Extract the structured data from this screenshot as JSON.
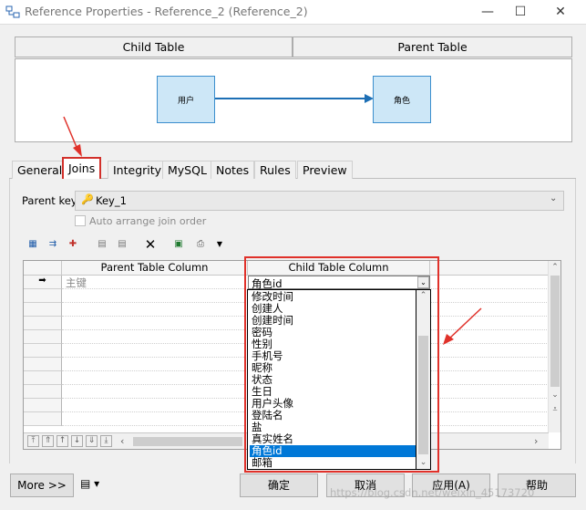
{
  "window": {
    "title": "Reference Properties - Reference_2 (Reference_2)",
    "controls": [
      "—",
      "☐",
      "✕"
    ]
  },
  "header_tabs": {
    "child": "Child Table",
    "parent": "Parent Table"
  },
  "diagram": {
    "child_entity": "用户",
    "parent_entity": "角色"
  },
  "tabs": [
    "General",
    "Joins",
    "Integrity",
    "MySQL",
    "Notes",
    "Rules",
    "Preview"
  ],
  "active_tab": "Joins",
  "parent_key": {
    "label": "Parent key:",
    "value": "Key_1"
  },
  "auto_arrange": {
    "label": "Auto arrange join order",
    "checked": false
  },
  "grid": {
    "columns": {
      "parent": "Parent Table Column",
      "child": "Child Table Column"
    },
    "rows": [
      {
        "parent": "主键",
        "child": "角色id"
      }
    ]
  },
  "dropdown": {
    "options": [
      "修改时间",
      "创建人",
      "创建时间",
      "密码",
      "性别",
      "手机号",
      "昵称",
      "状态",
      "生日",
      "用户头像",
      "登陆名",
      "盐",
      "真实姓名",
      "角色id",
      "邮箱"
    ],
    "selected": "角色id"
  },
  "buttons": {
    "more": "More >>",
    "ok": "确定",
    "cancel": "取消",
    "apply": "应用(A)",
    "help": "帮助"
  },
  "watermark": "https://blog.csdn.net/weixin_45173720",
  "colors": {
    "highlight": "#0078d7",
    "annotation": "#e0312a",
    "entity_fill": "#cde7f7"
  }
}
